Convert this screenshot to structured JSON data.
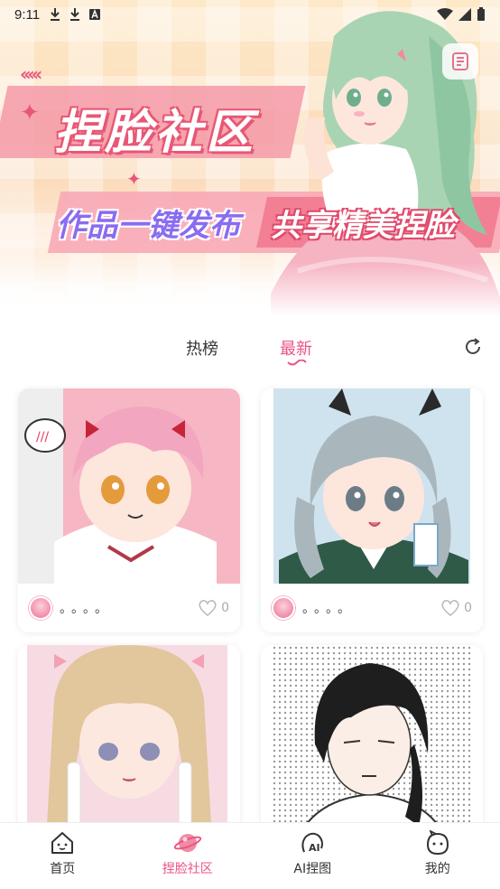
{
  "status_bar": {
    "time": "9:11",
    "left_icons": [
      "download-icon",
      "download-icon",
      "a-box-icon"
    ],
    "right_icons": [
      "wifi-icon",
      "signal-icon",
      "battery-icon"
    ]
  },
  "banner": {
    "title": "捏脸社区",
    "subtitle_left": "作品一键发布",
    "subtitle_right": "共享精美捏脸",
    "chevrons_left": "‹‹‹‹‹",
    "chevrons_right": "›››››",
    "doc_icon": "document-icon"
  },
  "tabs": {
    "items": [
      {
        "label": "热榜",
        "active": false
      },
      {
        "label": "最新",
        "active": true
      }
    ],
    "refresh_icon": "refresh-icon"
  },
  "cards": [
    {
      "name": "。。。。",
      "likes": "0",
      "image": "pink-hair-girl"
    },
    {
      "name": "。。。。",
      "likes": "0",
      "image": "silver-hair-cat-girl"
    },
    {
      "name": "",
      "likes": "",
      "image": "blonde-bow-girl"
    },
    {
      "name": "",
      "likes": "",
      "image": "black-hair-boy"
    }
  ],
  "bottom_nav": {
    "items": [
      {
        "label": "首页",
        "icon": "home-icon",
        "active": false
      },
      {
        "label": "捏脸社区",
        "icon": "planet-icon",
        "active": true
      },
      {
        "label": "AI捏图",
        "icon": "ai-icon",
        "active": false
      },
      {
        "label": "我的",
        "icon": "profile-icon",
        "active": false
      }
    ]
  },
  "colors": {
    "accent": "#ea5484",
    "banner_pink": "#f59aa8",
    "banner_purple": "#8a6cf0"
  }
}
